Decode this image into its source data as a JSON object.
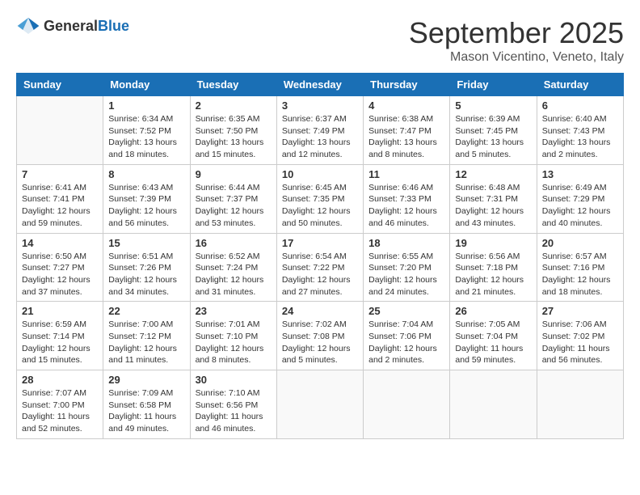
{
  "header": {
    "logo": {
      "general": "General",
      "blue": "Blue"
    },
    "title": "September 2025",
    "location": "Mason Vicentino, Veneto, Italy"
  },
  "days_of_week": [
    "Sunday",
    "Monday",
    "Tuesday",
    "Wednesday",
    "Thursday",
    "Friday",
    "Saturday"
  ],
  "weeks": [
    [
      {
        "day": "",
        "info": ""
      },
      {
        "day": "1",
        "info": "Sunrise: 6:34 AM\nSunset: 7:52 PM\nDaylight: 13 hours\nand 18 minutes."
      },
      {
        "day": "2",
        "info": "Sunrise: 6:35 AM\nSunset: 7:50 PM\nDaylight: 13 hours\nand 15 minutes."
      },
      {
        "day": "3",
        "info": "Sunrise: 6:37 AM\nSunset: 7:49 PM\nDaylight: 13 hours\nand 12 minutes."
      },
      {
        "day": "4",
        "info": "Sunrise: 6:38 AM\nSunset: 7:47 PM\nDaylight: 13 hours\nand 8 minutes."
      },
      {
        "day": "5",
        "info": "Sunrise: 6:39 AM\nSunset: 7:45 PM\nDaylight: 13 hours\nand 5 minutes."
      },
      {
        "day": "6",
        "info": "Sunrise: 6:40 AM\nSunset: 7:43 PM\nDaylight: 13 hours\nand 2 minutes."
      }
    ],
    [
      {
        "day": "7",
        "info": "Sunrise: 6:41 AM\nSunset: 7:41 PM\nDaylight: 12 hours\nand 59 minutes."
      },
      {
        "day": "8",
        "info": "Sunrise: 6:43 AM\nSunset: 7:39 PM\nDaylight: 12 hours\nand 56 minutes."
      },
      {
        "day": "9",
        "info": "Sunrise: 6:44 AM\nSunset: 7:37 PM\nDaylight: 12 hours\nand 53 minutes."
      },
      {
        "day": "10",
        "info": "Sunrise: 6:45 AM\nSunset: 7:35 PM\nDaylight: 12 hours\nand 50 minutes."
      },
      {
        "day": "11",
        "info": "Sunrise: 6:46 AM\nSunset: 7:33 PM\nDaylight: 12 hours\nand 46 minutes."
      },
      {
        "day": "12",
        "info": "Sunrise: 6:48 AM\nSunset: 7:31 PM\nDaylight: 12 hours\nand 43 minutes."
      },
      {
        "day": "13",
        "info": "Sunrise: 6:49 AM\nSunset: 7:29 PM\nDaylight: 12 hours\nand 40 minutes."
      }
    ],
    [
      {
        "day": "14",
        "info": "Sunrise: 6:50 AM\nSunset: 7:27 PM\nDaylight: 12 hours\nand 37 minutes."
      },
      {
        "day": "15",
        "info": "Sunrise: 6:51 AM\nSunset: 7:26 PM\nDaylight: 12 hours\nand 34 minutes."
      },
      {
        "day": "16",
        "info": "Sunrise: 6:52 AM\nSunset: 7:24 PM\nDaylight: 12 hours\nand 31 minutes."
      },
      {
        "day": "17",
        "info": "Sunrise: 6:54 AM\nSunset: 7:22 PM\nDaylight: 12 hours\nand 27 minutes."
      },
      {
        "day": "18",
        "info": "Sunrise: 6:55 AM\nSunset: 7:20 PM\nDaylight: 12 hours\nand 24 minutes."
      },
      {
        "day": "19",
        "info": "Sunrise: 6:56 AM\nSunset: 7:18 PM\nDaylight: 12 hours\nand 21 minutes."
      },
      {
        "day": "20",
        "info": "Sunrise: 6:57 AM\nSunset: 7:16 PM\nDaylight: 12 hours\nand 18 minutes."
      }
    ],
    [
      {
        "day": "21",
        "info": "Sunrise: 6:59 AM\nSunset: 7:14 PM\nDaylight: 12 hours\nand 15 minutes."
      },
      {
        "day": "22",
        "info": "Sunrise: 7:00 AM\nSunset: 7:12 PM\nDaylight: 12 hours\nand 11 minutes."
      },
      {
        "day": "23",
        "info": "Sunrise: 7:01 AM\nSunset: 7:10 PM\nDaylight: 12 hours\nand 8 minutes."
      },
      {
        "day": "24",
        "info": "Sunrise: 7:02 AM\nSunset: 7:08 PM\nDaylight: 12 hours\nand 5 minutes."
      },
      {
        "day": "25",
        "info": "Sunrise: 7:04 AM\nSunset: 7:06 PM\nDaylight: 12 hours\nand 2 minutes."
      },
      {
        "day": "26",
        "info": "Sunrise: 7:05 AM\nSunset: 7:04 PM\nDaylight: 11 hours\nand 59 minutes."
      },
      {
        "day": "27",
        "info": "Sunrise: 7:06 AM\nSunset: 7:02 PM\nDaylight: 11 hours\nand 56 minutes."
      }
    ],
    [
      {
        "day": "28",
        "info": "Sunrise: 7:07 AM\nSunset: 7:00 PM\nDaylight: 11 hours\nand 52 minutes."
      },
      {
        "day": "29",
        "info": "Sunrise: 7:09 AM\nSunset: 6:58 PM\nDaylight: 11 hours\nand 49 minutes."
      },
      {
        "day": "30",
        "info": "Sunrise: 7:10 AM\nSunset: 6:56 PM\nDaylight: 11 hours\nand 46 minutes."
      },
      {
        "day": "",
        "info": ""
      },
      {
        "day": "",
        "info": ""
      },
      {
        "day": "",
        "info": ""
      },
      {
        "day": "",
        "info": ""
      }
    ]
  ]
}
